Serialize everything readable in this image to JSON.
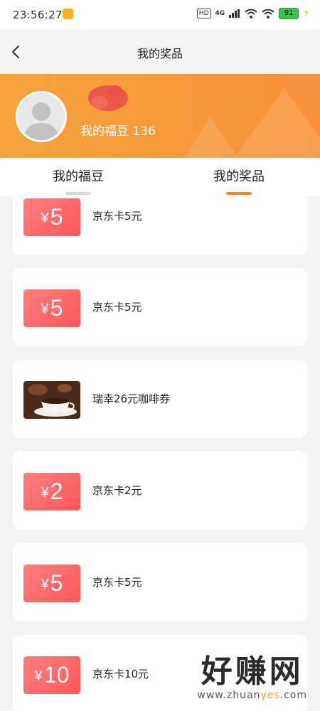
{
  "status_bar": {
    "time": "23:56:27",
    "hd": "HD",
    "network": "4G",
    "battery": "91"
  },
  "nav": {
    "title": "我的奖品"
  },
  "profile": {
    "fudou_label": "我的福豆 136"
  },
  "tabs": [
    {
      "label": "我的福豆",
      "active": false
    },
    {
      "label": "我的奖品",
      "active": true
    }
  ],
  "prizes": [
    {
      "type": "coupon",
      "symbol": "¥",
      "amount": "5",
      "label": "京东卡5元"
    },
    {
      "type": "coupon",
      "symbol": "¥",
      "amount": "5",
      "label": "京东卡5元"
    },
    {
      "type": "coffee",
      "label": "瑞幸26元咖啡券"
    },
    {
      "type": "coupon",
      "symbol": "¥",
      "amount": "2",
      "label": "京东卡2元"
    },
    {
      "type": "coupon",
      "symbol": "¥",
      "amount": "5",
      "label": "京东卡5元"
    },
    {
      "type": "coupon",
      "symbol": "¥",
      "amount": "10",
      "label": "京东卡10元"
    }
  ],
  "watermark": {
    "main": "好赚网",
    "sub_before": "www.zhuan",
    "sub_highlight": "yes",
    "sub_after": ".com"
  },
  "colors": {
    "accent": "#f2871f",
    "banner_start": "#f5a43a",
    "banner_end": "#f7913a",
    "coupon": "#ff6464"
  }
}
